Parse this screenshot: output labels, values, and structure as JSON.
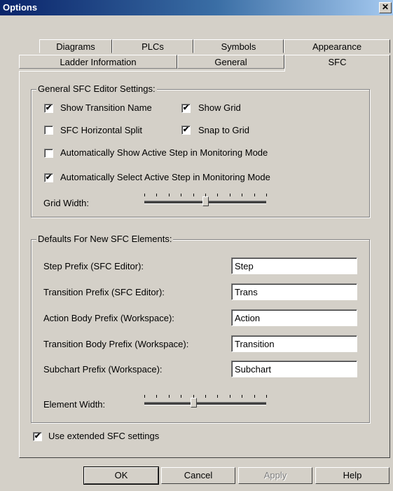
{
  "window": {
    "title": "Options",
    "close_glyph": "✕"
  },
  "tabs_back": [
    "Diagrams",
    "PLCs",
    "Symbols",
    "Appearance"
  ],
  "tabs_front": [
    "Ladder Information",
    "General",
    "SFC"
  ],
  "active_tab": "SFC",
  "general": {
    "legend": "General SFC Editor Settings:",
    "show_transition_name": {
      "label": "Show Transition Name",
      "checked": true
    },
    "show_grid": {
      "label": "Show Grid",
      "checked": true
    },
    "horizontal_split": {
      "label": "SFC Horizontal Split",
      "checked": false
    },
    "snap_to_grid": {
      "label": "Snap to Grid",
      "checked": true
    },
    "auto_show_active": {
      "label": "Automatically Show Active Step in Monitoring Mode",
      "checked": false
    },
    "auto_select_active": {
      "label": "Automatically Select Active Step in Monitoring Mode",
      "checked": true
    },
    "grid_width_label": "Grid Width:",
    "grid_width_level": 0.5
  },
  "defaults": {
    "legend": "Defaults For New SFC Elements:",
    "fields": [
      {
        "label": "Step Prefix (SFC Editor):",
        "value": "Step"
      },
      {
        "label": "Transition Prefix (SFC Editor):",
        "value": "Trans"
      },
      {
        "label": "Action Body Prefix (Workspace):",
        "value": "Action"
      },
      {
        "label": "Transition Body Prefix (Workspace):",
        "value": "Transition"
      },
      {
        "label": "Subchart Prefix (Workspace):",
        "value": "Subchart"
      }
    ],
    "element_width_label": "Element Width:",
    "element_width_level": 0.4
  },
  "use_extended": {
    "label": "Use extended SFC settings",
    "checked": true
  },
  "buttons": {
    "ok": "OK",
    "cancel": "Cancel",
    "apply": "Apply",
    "help": "Help"
  },
  "check_glyph": "✔"
}
